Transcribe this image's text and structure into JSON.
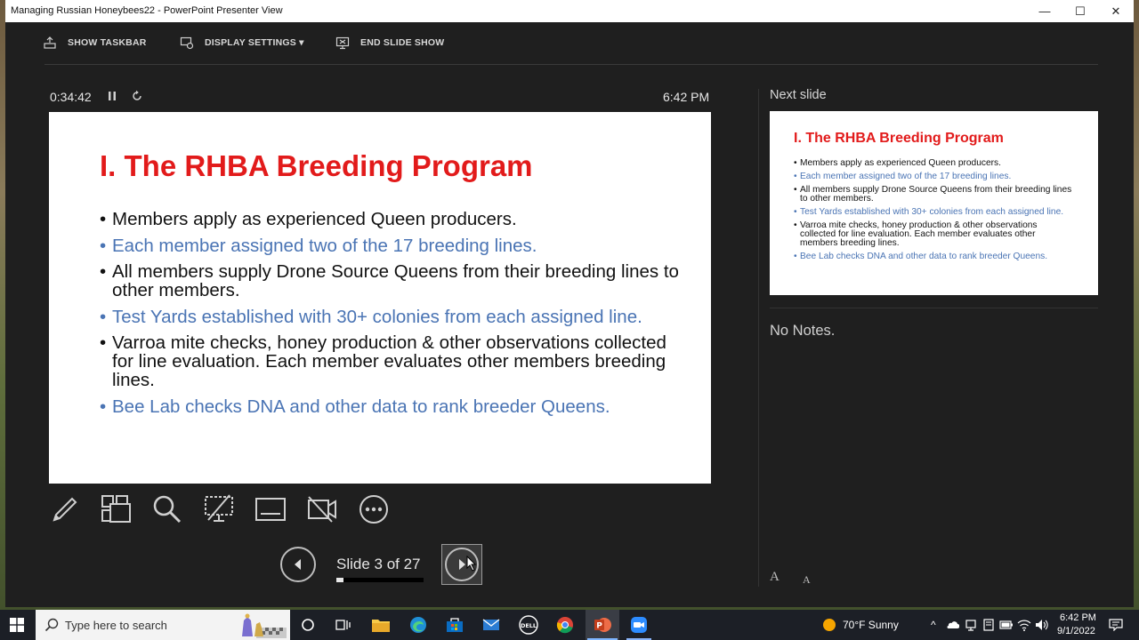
{
  "window": {
    "title": "Managing Russian Honeybees22 - PowerPoint Presenter View",
    "minimize_glyph": "—",
    "maximize_glyph": "☐",
    "close_glyph": "✕"
  },
  "toolbar": {
    "show_taskbar": "SHOW TASKBAR",
    "display_settings": "DISPLAY SETTINGS ▾",
    "end_show": "END SLIDE SHOW"
  },
  "timer": {
    "elapsed": "0:34:42",
    "clock": "6:42 PM"
  },
  "slide": {
    "title": "I. The RHBA Breeding Program",
    "bullets": [
      {
        "text": "Members apply as experienced Queen producers.",
        "color": "black"
      },
      {
        "text": "Each member assigned two of the 17 breeding lines.",
        "color": "blue"
      },
      {
        "text": "All members supply Drone Source Queens from their breeding lines to other members.",
        "color": "black"
      },
      {
        "text": "Test Yards established with 30+ colonies from each assigned line.",
        "color": "blue"
      },
      {
        "text": "Varroa mite checks, honey production & other observations collected for line evaluation. Each member evaluates other members breeding lines.",
        "color": "black"
      },
      {
        "text": "Bee Lab checks DNA and other data to rank breeder Queens.",
        "color": "blue"
      }
    ]
  },
  "navigation": {
    "slide_counter": "Slide 3 of 27",
    "current": 3,
    "total": 27
  },
  "next_slide": {
    "label": "Next slide"
  },
  "notes": {
    "text": "No Notes."
  },
  "font_buttons": {
    "increase": "A",
    "decrease": "A"
  },
  "taskbar": {
    "search_placeholder": "Type here to search",
    "weather": "70°F  Sunny",
    "time": "6:42 PM",
    "date": "9/1/2022"
  },
  "colors": {
    "slide_title": "#e21b1b",
    "bullet_blue": "#4a74b4",
    "bullet_black": "#111111",
    "presenter_bg": "#1f1f1f"
  }
}
